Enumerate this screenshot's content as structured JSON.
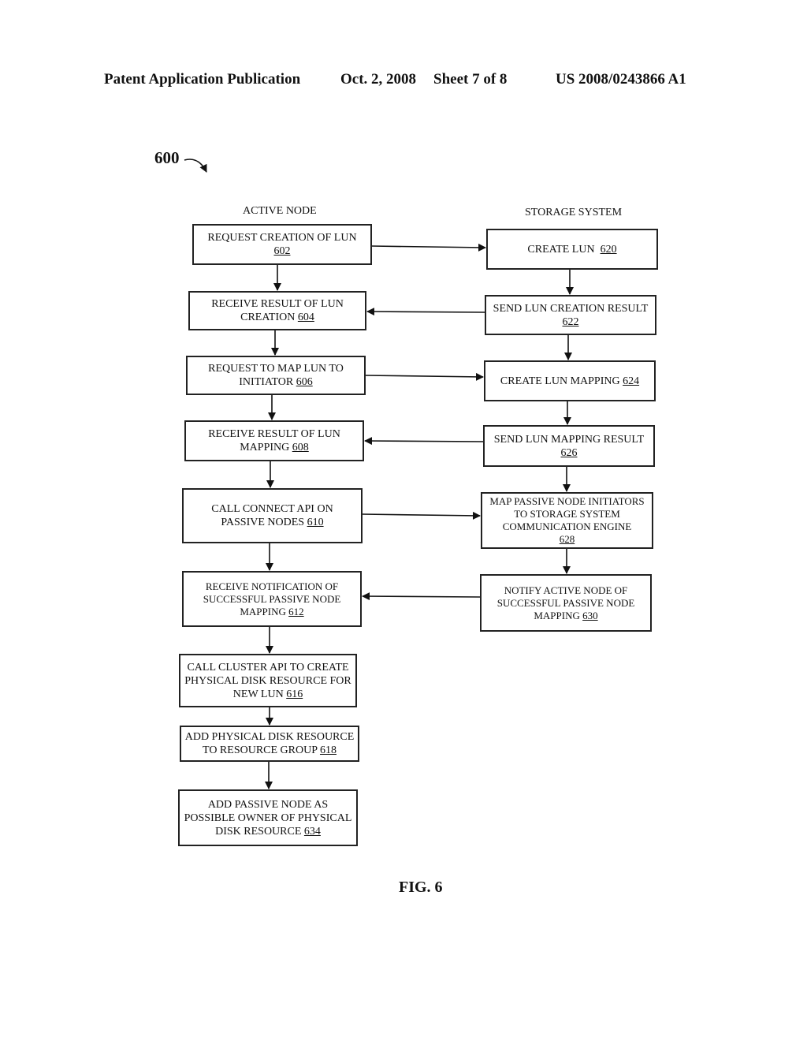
{
  "header": {
    "left": "Patent Application Publication",
    "date": "Oct. 2, 2008",
    "sheet": "Sheet 7 of 8",
    "number": "US 2008/0243866 A1"
  },
  "figure_ref": "600",
  "lanes": {
    "left": "ACTIVE NODE",
    "right": "STORAGE SYSTEM"
  },
  "boxes": {
    "b602": {
      "text": "REQUEST CREATION OF LUN",
      "ref": "602"
    },
    "b604": {
      "text": "RECEIVE RESULT OF LUN CREATION",
      "ref": "604"
    },
    "b606": {
      "text": "REQUEST TO MAP LUN TO INITIATOR",
      "ref": "606"
    },
    "b608": {
      "text": "RECEIVE RESULT OF LUN MAPPING",
      "ref": "608"
    },
    "b610": {
      "text": "CALL CONNECT API ON PASSIVE NODES",
      "ref": "610"
    },
    "b612": {
      "text": "RECEIVE NOTIFICATION OF SUCCESSFUL PASSIVE NODE MAPPING",
      "ref": "612"
    },
    "b616": {
      "text": "CALL CLUSTER API TO CREATE PHYSICAL DISK RESOURCE FOR NEW LUN",
      "ref": "616"
    },
    "b618": {
      "text": "ADD PHYSICAL DISK RESOURCE TO RESOURCE GROUP",
      "ref": "618"
    },
    "b634": {
      "text": "ADD PASSIVE NODE AS POSSIBLE OWNER OF PHYSICAL DISK RESOURCE",
      "ref": "634"
    },
    "b620": {
      "text": "CREATE LUN",
      "ref": "620"
    },
    "b622": {
      "text": "SEND LUN CREATION RESULT",
      "ref": "622"
    },
    "b624": {
      "text": "CREATE LUN MAPPING",
      "ref": "624"
    },
    "b626": {
      "text": "SEND LUN MAPPING RESULT",
      "ref": "626"
    },
    "b628": {
      "text": "MAP PASSIVE NODE INITIATORS TO STORAGE SYSTEM COMMUNICATION ENGINE",
      "ref": "628"
    },
    "b630": {
      "text": "NOTIFY ACTIVE NODE OF SUCCESSFUL PASSIVE NODE MAPPING",
      "ref": "630"
    }
  },
  "caption": "FIG. 6"
}
